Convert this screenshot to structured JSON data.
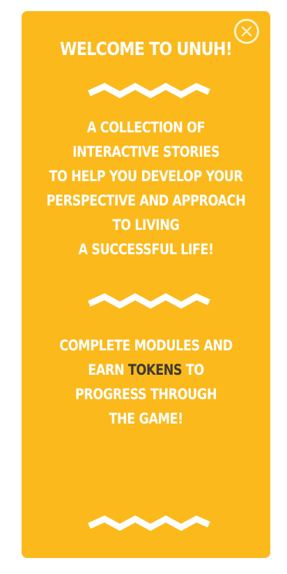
{
  "modal": {
    "title": "WELCOME TO UNUH!",
    "intro_lines": [
      "A COLLECTION OF",
      "INTERACTIVE STORIES",
      "TO HELP YOU DEVELOP YOUR",
      "PERSPECTIVE AND APPROACH",
      "TO LIVING",
      "A SUCCESSFUL LIFE!"
    ],
    "progress_lines": {
      "line1": "COMPLETE MODULES AND",
      "line2_before": "EARN ",
      "line2_highlight": "TOKENS",
      "line2_after": " TO",
      "line3": "PROGRESS THROUGH",
      "line4": "THE GAME!"
    },
    "close_icon": "close-circle-icon",
    "divider_icon": "zigzag-divider-icon"
  },
  "colors": {
    "card_background": "#fbb91c",
    "text": "#ffffff",
    "highlight": "#3d3a36",
    "close_ring": "#fff3cf"
  }
}
